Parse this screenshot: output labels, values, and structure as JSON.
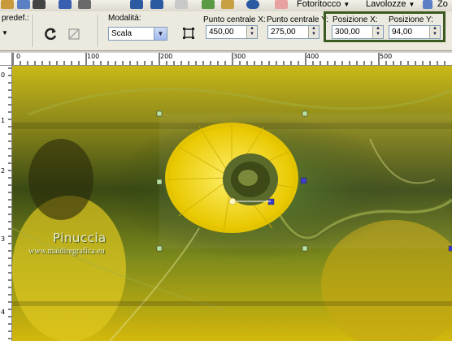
{
  "menubar": {
    "fotoritocco": "Fotoritocco",
    "lavolozze": "Lavolozze",
    "zoom_partial": "Zo"
  },
  "toolbar": {
    "preset_label": "predef.:",
    "mode_label": "Modalità:",
    "mode_value": "Scala",
    "center_x_label": "Punto centrale X:",
    "center_x_value": "450,00",
    "center_y_label": "Punto centrale Y:",
    "center_y_value": "275,00",
    "pos_x_label": "Posizione X:",
    "pos_x_value": "300,00",
    "pos_y_label": "Posizione Y:",
    "pos_y_value": "94,00"
  },
  "ruler": {
    "h_ticks": [
      "0",
      "100",
      "200",
      "300",
      "400",
      "500"
    ],
    "v_ticks": [
      "0",
      "1",
      "2",
      "3",
      "4"
    ]
  },
  "canvas": {
    "watermark_title": "Pinuccia",
    "watermark_url": "www.maidiregrafica.eu"
  },
  "colors": {
    "highlight_frame": "#3b5a1f",
    "handle_blue": "#3c3cc8",
    "handle_green": "#b8e0a0"
  }
}
